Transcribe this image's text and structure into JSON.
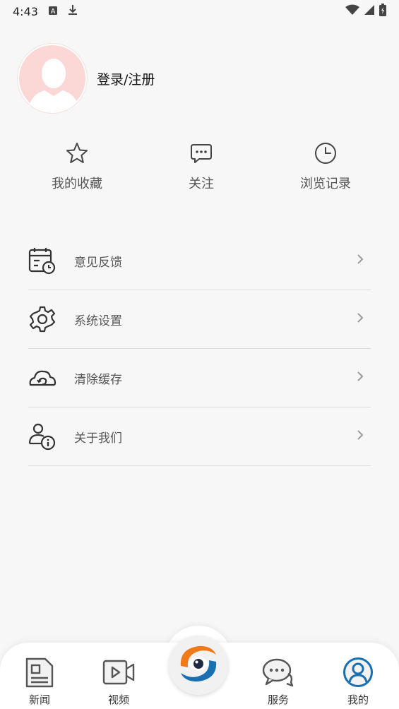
{
  "status_bar": {
    "time": "4:43",
    "icons": [
      "a-box-icon",
      "download-icon",
      "wifi-icon",
      "signal-icon",
      "battery-icon"
    ]
  },
  "profile": {
    "login_label": "登录/注册"
  },
  "quick_actions": [
    {
      "label": "我的收藏",
      "icon": "star-icon"
    },
    {
      "label": "关注",
      "icon": "chat-icon"
    },
    {
      "label": "浏览记录",
      "icon": "clock-icon"
    }
  ],
  "menu": [
    {
      "label": "意见反馈",
      "icon": "calendar-clock-icon"
    },
    {
      "label": "系统设置",
      "icon": "gear-icon"
    },
    {
      "label": "清除缓存",
      "icon": "cloud-refresh-icon"
    },
    {
      "label": "关于我们",
      "icon": "user-info-icon"
    }
  ],
  "tabbar": {
    "tabs": [
      {
        "label": "新闻",
        "icon": "news-icon"
      },
      {
        "label": "视频",
        "icon": "video-icon"
      },
      {
        "label": "服务",
        "icon": "service-chat-icon"
      },
      {
        "label": "我的",
        "icon": "profile-icon"
      }
    ],
    "active": "我的",
    "colors": {
      "active": "#1a6fb0",
      "inactive": "#555555",
      "logo_orange": "#f07a1a",
      "logo_blue": "#1a6fb0"
    }
  }
}
